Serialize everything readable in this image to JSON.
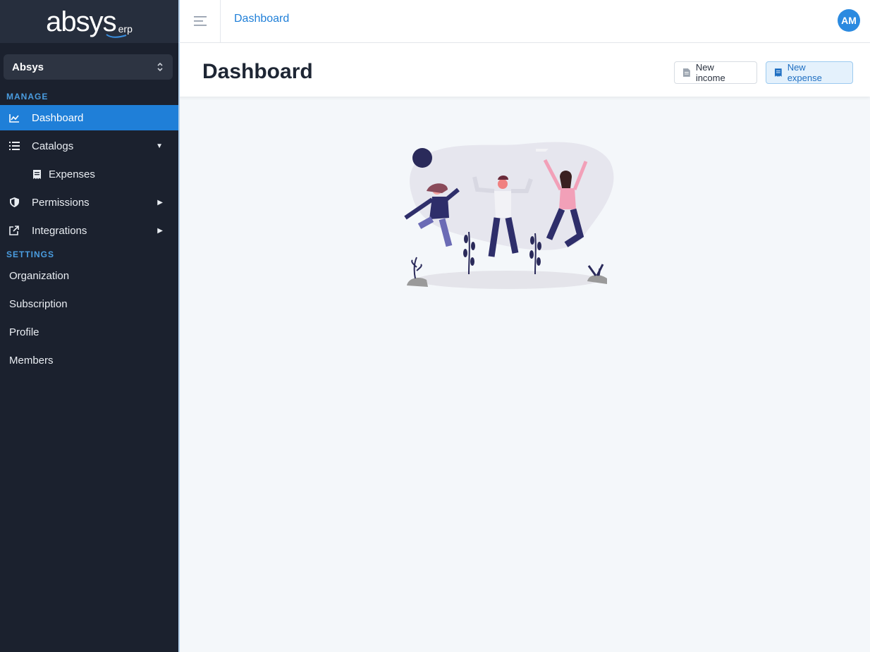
{
  "sidebar": {
    "logo": {
      "main": "absys",
      "suffix": "erp"
    },
    "org_selector": {
      "value": "Absys"
    },
    "sections": {
      "manage": "MANAGE",
      "settings": "SETTINGS"
    },
    "manage_items": [
      {
        "label": "Dashboard",
        "icon": "chart-line-icon",
        "active": true
      },
      {
        "label": "Catalogs",
        "icon": "list-icon",
        "expanded": true
      },
      {
        "label": "Expenses",
        "icon": "receipt-icon"
      },
      {
        "label": "Permissions",
        "icon": "shield-icon"
      },
      {
        "label": "Integrations",
        "icon": "external-link-icon"
      }
    ],
    "settings_items": [
      {
        "label": "Organization"
      },
      {
        "label": "Subscription"
      },
      {
        "label": "Profile"
      },
      {
        "label": "Members"
      }
    ]
  },
  "topbar": {
    "title": "Dashboard",
    "avatar_initials": "AM"
  },
  "page": {
    "title": "Dashboard",
    "new_income_label": "New income",
    "new_expense_label": "New expense"
  },
  "colors": {
    "sidebar_bg": "#1b212e",
    "accent": "#1f7fd8",
    "section_label": "#4a9de0"
  }
}
